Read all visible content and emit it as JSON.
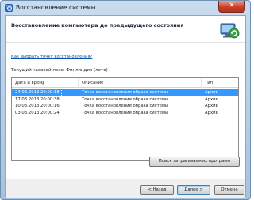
{
  "window": {
    "title": "Восстановление системы",
    "close_glyph": "✕"
  },
  "header": {
    "title": "Восстановление компьютера до предыдущего состояния",
    "icon": "system-restore-icon"
  },
  "help_link": "Как выбрать точку восстановления?",
  "timezone_label": "Текущий часовой пояс: Финляндия (лето)",
  "table": {
    "columns": [
      "Дата и время",
      "Описание",
      "Тип"
    ],
    "sort_glyph": "▲",
    "rows": [
      {
        "date": "24.03.2013 20:00:18",
        "description": "Точка восстановления образа системы",
        "type": "Архив",
        "selected": true
      },
      {
        "date": "17.03.2013 20:00:38",
        "description": "Точка восстановления образа системы",
        "type": "Архив",
        "selected": false
      },
      {
        "date": "10.03.2013 20:00:16",
        "description": "Точка восстановления образа системы",
        "type": "Архив",
        "selected": false
      },
      {
        "date": "03.03.2013 20:00:24",
        "description": "Точка восстановления образа системы",
        "type": "Архив",
        "selected": false
      }
    ]
  },
  "buttons": {
    "scan": "Поиск затрагиваемых программ",
    "back": "< Назад",
    "next": "Далее >",
    "cancel": "Отмена"
  },
  "colors": {
    "selection": "#3399ff",
    "link": "#0b54a8",
    "close": "#c7412b"
  }
}
